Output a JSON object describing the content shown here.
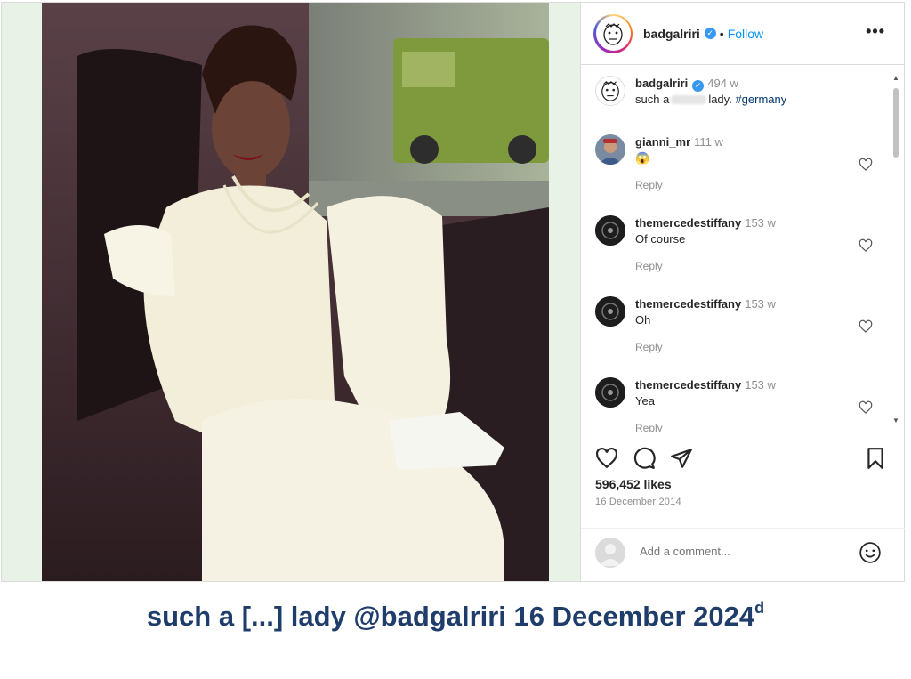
{
  "post": {
    "username": "badgalriri",
    "follow_label": "Follow",
    "separator": "•",
    "more_label": "•••"
  },
  "comments": [
    {
      "username": "badgalriri",
      "time": "494 w",
      "text_before": "such a",
      "text_after": "lady.",
      "hashtag": "#germany",
      "is_caption": true
    },
    {
      "username": "gianni_mr",
      "time": "111 w",
      "text": "😱",
      "reply": "Reply"
    },
    {
      "username": "themercedestiffany",
      "time": "153 w",
      "text": "Of course",
      "reply": "Reply"
    },
    {
      "username": "themercedestiffany",
      "time": "153 w",
      "text": "Oh",
      "reply": "Reply"
    },
    {
      "username": "themercedestiffany",
      "time": "153 w",
      "text": "Yea",
      "reply": "Reply"
    }
  ],
  "stats": {
    "likes": "596,452 likes",
    "date": "16 December 2014"
  },
  "composer": {
    "placeholder": "Add a comment..."
  },
  "icons": {
    "verified": "verified-badge-icon",
    "like": "heart-icon",
    "comment": "comment-icon",
    "share": "send-icon",
    "save": "bookmark-icon",
    "emoji": "emoji-icon",
    "more": "more-options-icon"
  },
  "colors": {
    "link_blue": "#0095f6",
    "verified_blue": "#3897f0",
    "caption_navy": "#1f3d6b",
    "muted_gray": "#8e8e8e"
  },
  "caption": {
    "text": "such a [...] lady @badgalriri 16 December 2024",
    "superscript": "d"
  }
}
